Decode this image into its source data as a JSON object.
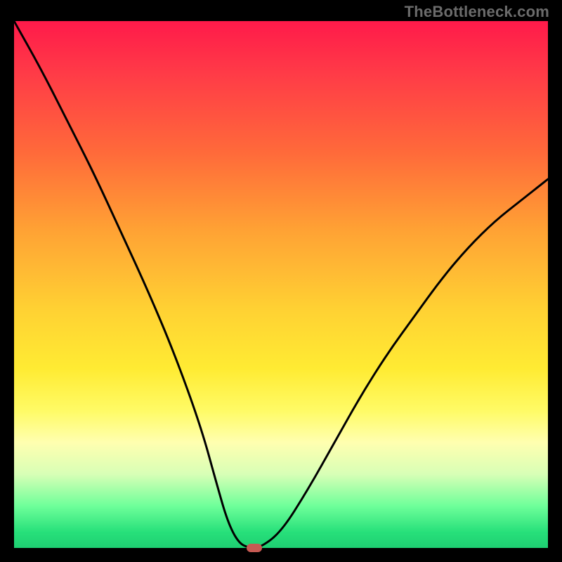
{
  "watermark": "TheBottleneck.com",
  "chart_data": {
    "type": "line",
    "title": "",
    "xlabel": "",
    "ylabel": "",
    "xlim": [
      0,
      100
    ],
    "ylim": [
      0,
      100
    ],
    "grid": false,
    "legend": false,
    "series": [
      {
        "name": "bottleneck-curve",
        "x": [
          0,
          5,
          10,
          15,
          20,
          25,
          30,
          35,
          38,
          40,
          42,
          44,
          46,
          50,
          55,
          60,
          65,
          70,
          75,
          80,
          85,
          90,
          95,
          100
        ],
        "values": [
          100,
          91,
          81,
          71,
          60,
          49,
          37,
          23,
          12,
          5,
          1,
          0,
          0,
          3,
          11,
          20,
          29,
          37,
          44,
          51,
          57,
          62,
          66,
          70
        ]
      }
    ],
    "background_gradient": {
      "stops": [
        {
          "pos": 0,
          "color": "#ff1a4a"
        },
        {
          "pos": 25,
          "color": "#ff6a3a"
        },
        {
          "pos": 55,
          "color": "#ffd233"
        },
        {
          "pos": 80,
          "color": "#ffffb0"
        },
        {
          "pos": 97,
          "color": "#27e07a"
        },
        {
          "pos": 100,
          "color": "#1ecf72"
        }
      ]
    },
    "marker": {
      "x": 45,
      "y": 0,
      "color": "#c65a53"
    }
  }
}
